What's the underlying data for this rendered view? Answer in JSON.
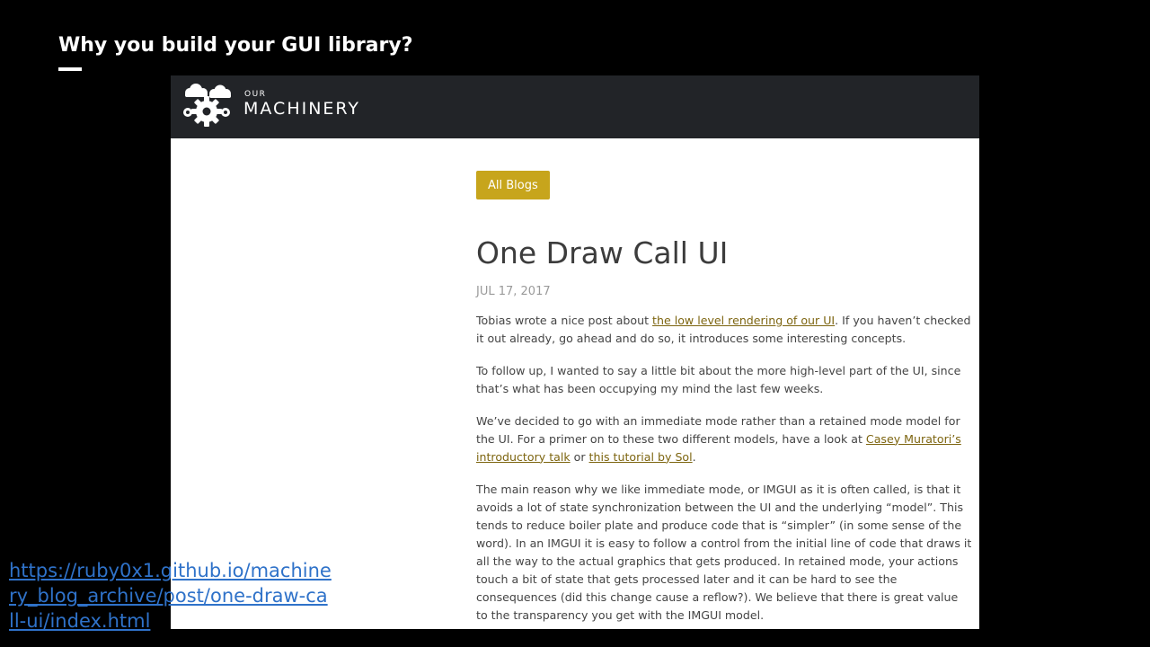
{
  "slide": {
    "title": "Why you build your GUI library?",
    "source_url": "https://ruby0x1.github.io/machinery_blog_archive/post/one-draw-call-ui/index.html"
  },
  "site": {
    "logo_small": "OUR",
    "logo_big": "MACHINERY",
    "logo_icon": "gears-clouds-icon"
  },
  "colors": {
    "header_bg": "#222428",
    "accent_button": "#c7a51c",
    "link": "#7d6510",
    "source_link": "#2f72c9"
  },
  "post": {
    "all_blogs_label": "All Blogs",
    "title": "One Draw Call UI",
    "date": "JUL 17, 2017",
    "p1": {
      "a": "Tobias wrote a nice post about ",
      "link1": "the low level rendering of our UI",
      "b": ". If you haven’t checked it out already, go ahead and do so, it introduces some interesting concepts."
    },
    "p2": "To follow up, I wanted to say a little bit about the more high-level part of the UI, since that’s what has been occupying my mind the last few weeks.",
    "p3": {
      "a": "We’ve decided to go with an immediate mode rather than a retained mode model for the UI. For a primer on to these two different models, have a look at ",
      "link1": "Casey Muratori’s introductory talk",
      "b": " or ",
      "link2": "this tutorial by Sol",
      "c": "."
    },
    "p4": "The main reason why we like immediate mode, or IMGUI as it is often called, is that it avoids a lot of state synchronization between the UI and the underlying “model”. This tends to reduce boiler plate and produce code that is “simpler” (in some sense of the word). In an IMGUI it is easy to follow a control from the initial line of code that draws it all the way to the actual graphics that gets produced. In retained mode, your actions touch a bit of state that gets processed later and it can be hard to see the consequences (did this change cause a reflow?). We believe that there is great value to the transparency you get with the IMGUI model."
  }
}
